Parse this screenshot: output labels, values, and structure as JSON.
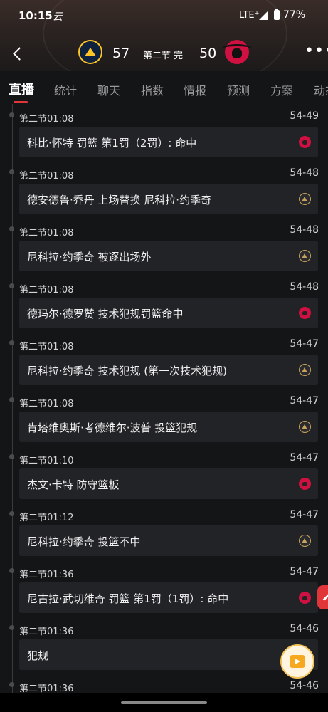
{
  "status_bar": {
    "time": "10:15",
    "app_icon": "云",
    "network": "LTE⁺",
    "battery": "77%"
  },
  "header": {
    "home_team_logo": "nuggets-logo",
    "home_score": "57",
    "game_status": "第二节 完",
    "away_score": "50",
    "away_team_logo": "bulls-logo",
    "more": "•••"
  },
  "tabs": [
    "直播",
    "统计",
    "聊天",
    "指数",
    "情报",
    "预测",
    "方案",
    "动态"
  ],
  "active_tab": "直播",
  "events": [
    {
      "time": "第二节01:08",
      "score": "54-49",
      "text": "科比·怀特 罚篮 第1罚（2罚）: 命中",
      "team": "bulls"
    },
    {
      "time": "第二节01:08",
      "score": "54-48",
      "text": "德安德鲁·乔丹 上场替换 尼科拉·约季奇",
      "team": "nuggets"
    },
    {
      "time": "第二节01:08",
      "score": "54-48",
      "text": "尼科拉·约季奇 被逐出场外",
      "team": "nuggets"
    },
    {
      "time": "第二节01:08",
      "score": "54-48",
      "text": "德玛尔·德罗赞 技术犯规罚篮命中",
      "team": "bulls"
    },
    {
      "time": "第二节01:08",
      "score": "54-47",
      "text": "尼科拉·约季奇 技术犯规 (第一次技术犯规)",
      "team": "nuggets"
    },
    {
      "time": "第二节01:08",
      "score": "54-47",
      "text": "肯塔维奥斯·考德维尔·波普 投篮犯规",
      "team": "nuggets"
    },
    {
      "time": "第二节01:10",
      "score": "54-47",
      "text": "杰文·卡特 防守篮板",
      "team": "bulls"
    },
    {
      "time": "第二节01:12",
      "score": "54-47",
      "text": "尼科拉·约季奇 投篮不中",
      "team": "nuggets"
    },
    {
      "time": "第二节01:36",
      "score": "54-47",
      "text": "尼古拉·武切维奇 罚篮 第1罚（1罚）: 命中",
      "team": "bulls"
    },
    {
      "time": "第二节01:36",
      "score": "54-46",
      "text": "犯规",
      "team": "none"
    },
    {
      "time": "第二节01:36",
      "score": "54-46",
      "text": "",
      "team": "none"
    }
  ],
  "colors": {
    "accent": "#e0363a",
    "background": "#141517",
    "card": "#222326",
    "bulls": "#ce1141",
    "nuggets": "#fec524"
  }
}
